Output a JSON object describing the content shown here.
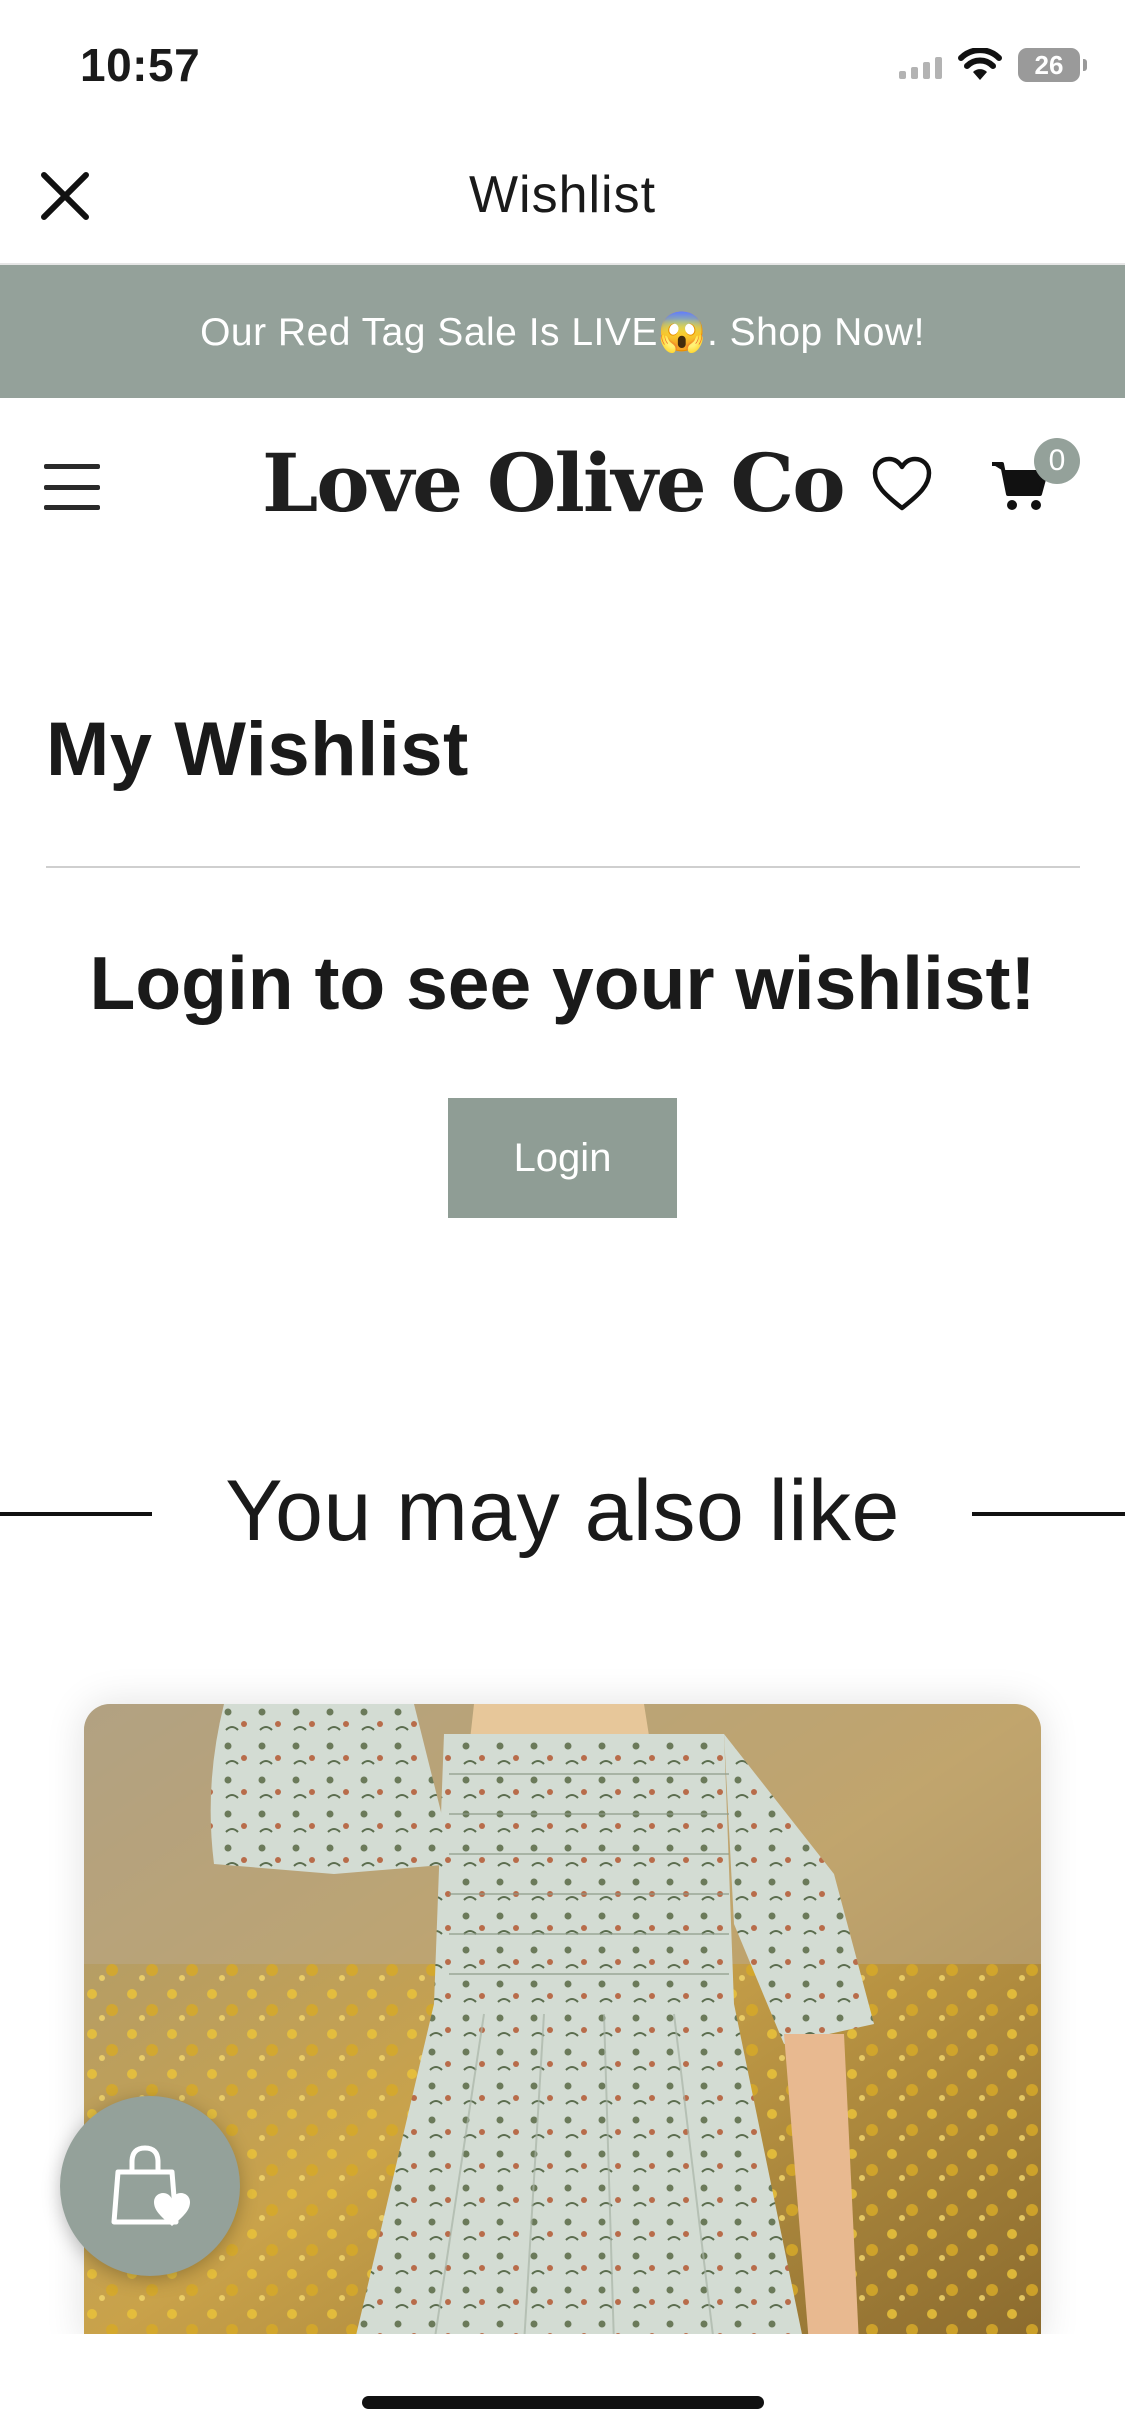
{
  "status_bar": {
    "time": "10:57",
    "battery_level": "26",
    "icons": [
      "signal-icon",
      "wifi-icon",
      "battery-icon"
    ]
  },
  "nav_header": {
    "title": "Wishlist",
    "close_icon": "close-icon"
  },
  "promo_banner": {
    "text": "Our Red Tag Sale Is LIVE😱. Shop Now!",
    "background": "#94a19a"
  },
  "store_header": {
    "logo": "Love Olive Co",
    "cart_count": "0",
    "icons": [
      "hamburger-menu-icon",
      "heart-icon",
      "cart-icon"
    ]
  },
  "wishlist": {
    "title": "My Wishlist",
    "login_message": "Login to see your wishlist!",
    "login_button": "Login"
  },
  "recommendations": {
    "title": "You may also like"
  },
  "floating_button": {
    "icon": "shopping-bag-heart-icon"
  },
  "colors": {
    "accent": "#94a19a",
    "text": "#1a1a1a"
  }
}
